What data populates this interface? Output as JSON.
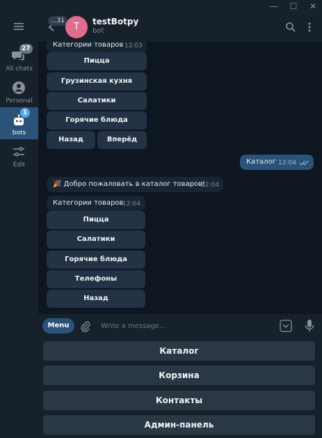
{
  "window": {
    "minimize_icon": "minimize-icon",
    "maximize_icon": "maximize-icon",
    "close_icon": "close-icon"
  },
  "sidebar": {
    "menu_icon": "hamburger-icon",
    "items": [
      {
        "label": "All chats",
        "badge": "27",
        "icon": "chats-icon"
      },
      {
        "label": "Personal",
        "icon": "person-icon"
      },
      {
        "label": "bots",
        "badge": "1",
        "icon": "bot-icon",
        "active": true
      },
      {
        "label": "Edit",
        "icon": "sliders-icon"
      }
    ]
  },
  "header": {
    "back_badge": "...31",
    "avatar_letter": "T",
    "title": "testBotpy",
    "subtitle": "bot",
    "search_icon": "search-icon",
    "more_icon": "more-vertical-icon"
  },
  "messages": {
    "first_group": {
      "title": "Категории товаров",
      "time": "12:03",
      "buttons": [
        "Пицца",
        "Грузинская кухня",
        "Салатики",
        "Горячие блюда"
      ],
      "nav_buttons": [
        "Назад",
        "Вперёд"
      ]
    },
    "outgoing": {
      "text": "Каталог",
      "time": "12:04"
    },
    "welcome": {
      "text": "🎉 Добро пожаловать в каталог товаров!",
      "time": "12:04"
    },
    "second_group": {
      "title": "Категории товаров",
      "time": "12:04",
      "buttons": [
        "Пицца",
        "Салатики",
        "Горячие блюда",
        "Телефоны",
        "Назад"
      ]
    }
  },
  "composer": {
    "menu_label": "Menu",
    "placeholder": "Write a message...",
    "attach_icon": "paperclip-icon",
    "keyboard_icon": "keyboard-toggle-icon",
    "mic_icon": "microphone-icon"
  },
  "reply_keyboard": {
    "buttons": [
      "Каталог",
      "Корзина",
      "Контакты",
      "Админ-панель"
    ]
  },
  "colors": {
    "background": "#0e1621",
    "panel": "#17212b",
    "accent": "#2b5278",
    "bubble_in": "#182533",
    "inline_button": "#233244",
    "badge": "#5aa9e6"
  }
}
